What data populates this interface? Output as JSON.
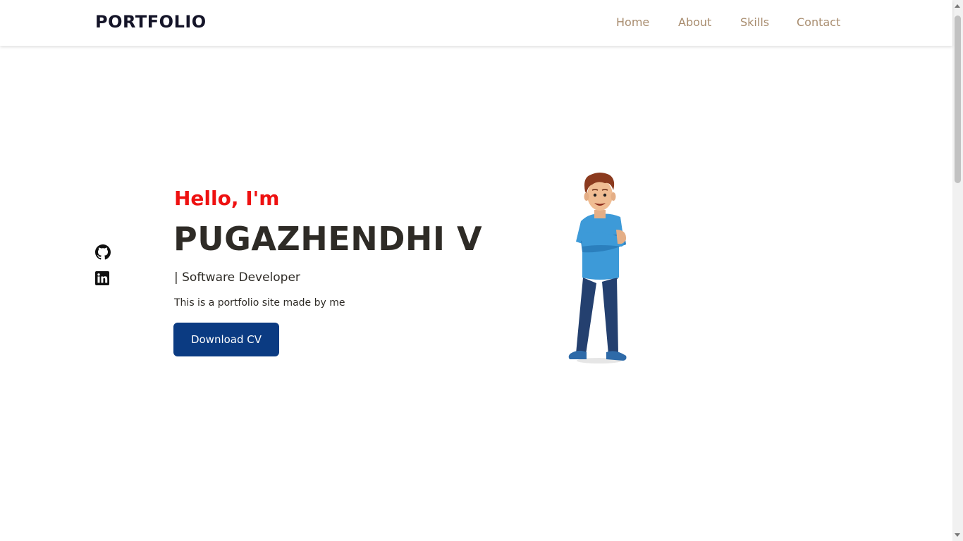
{
  "nav": {
    "brand": "PORTFOLIO",
    "links": [
      "Home",
      "About",
      "Skills",
      "Contact"
    ]
  },
  "social": {
    "icons": [
      "github-icon",
      "linkedin-icon"
    ]
  },
  "hero": {
    "greeting": "Hello, I'm",
    "name": "PUGAZHENDHI V",
    "role": "| Software Developer",
    "description": "This is a portfolio site made by me",
    "cta_label": "Download CV"
  },
  "colors": {
    "nav_link": "#a88c6e",
    "greeting": "#ee1111",
    "heading": "#2e2b26",
    "button_bg": "#0b3b82"
  }
}
